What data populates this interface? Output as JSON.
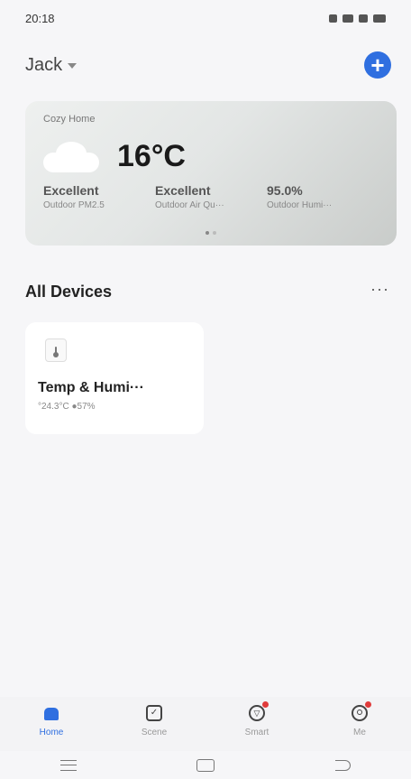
{
  "status_bar": {
    "time": "20:18"
  },
  "header": {
    "home_name": "Jack",
    "add_label": "+"
  },
  "weather": {
    "home_label": "Cozy Home",
    "temperature": "16°C",
    "metrics": [
      {
        "value": "Excellent",
        "label": "Outdoor PM2.5"
      },
      {
        "value": "Excellent",
        "label": "Outdoor Air Qu···"
      },
      {
        "value": "95.0%",
        "label": "Outdoor Humi···"
      }
    ],
    "page_count": 2,
    "active_page": 1
  },
  "devices_section": {
    "title": "All Devices",
    "more_label": "···"
  },
  "devices": [
    {
      "name": "Temp & Humi···",
      "readings": "°24.3°C  ●57%"
    }
  ],
  "tab_bar": {
    "tabs": [
      {
        "label": "Home",
        "icon": "home-icon",
        "active": true
      },
      {
        "label": "Scene",
        "icon": "scene-icon",
        "active": false
      },
      {
        "label": "Smart",
        "icon": "smart-icon",
        "active": false,
        "badge": true
      },
      {
        "label": "Me",
        "icon": "me-icon",
        "active": false,
        "badge": true
      }
    ]
  },
  "colors": {
    "accent": "#2f6fe0",
    "badge": "#e03b3b"
  }
}
